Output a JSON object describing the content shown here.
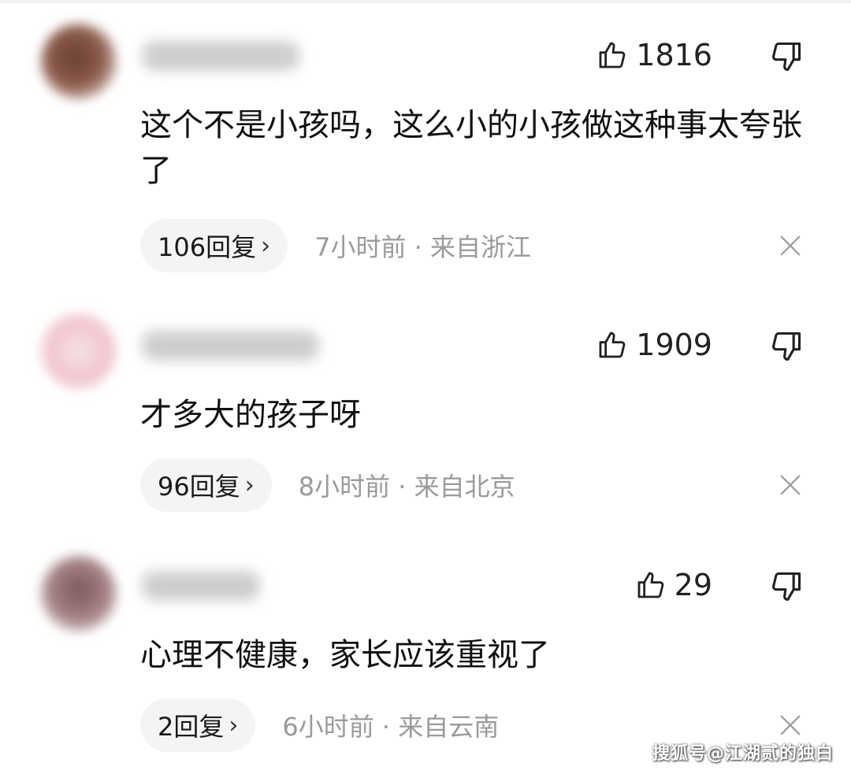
{
  "comments": [
    {
      "likes": "1816",
      "text": "这个不是小孩吗，这么小的小孩做这种事太夸张了",
      "replies": "106回复",
      "time": "7小时前",
      "location": "来自浙江"
    },
    {
      "likes": "1909",
      "text": "才多大的孩子呀",
      "replies": "96回复",
      "time": "8小时前",
      "location": "来自北京"
    },
    {
      "likes": "29",
      "text": "心理不健康，家长应该重视了",
      "replies": "2回复",
      "time": "6小时前",
      "location": "来自云南"
    }
  ],
  "separator": "·",
  "reply_chevron": "›",
  "watermark": "搜狐号@江湖贰的独白",
  "icons": {
    "like": "thumbs-up-icon",
    "dislike": "thumbs-down-icon",
    "close": "close-icon"
  }
}
